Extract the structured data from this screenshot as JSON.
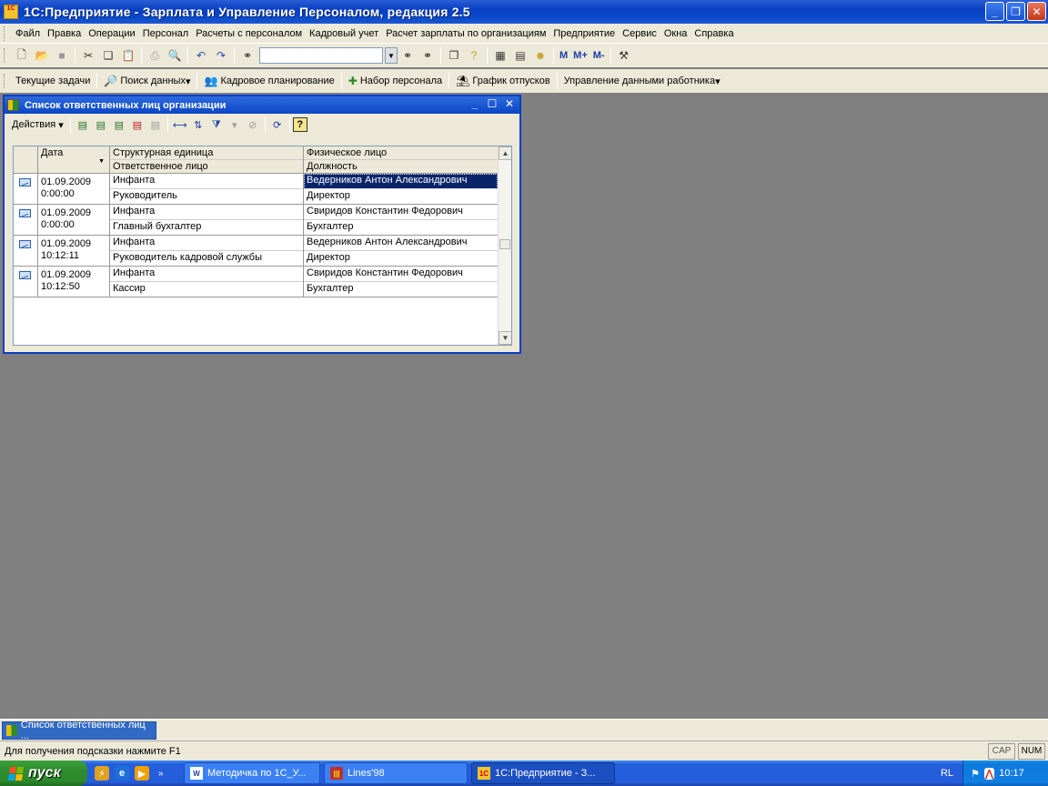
{
  "app": {
    "title": "1С:Предприятие - Зарплата и Управление Персоналом, редакция 2.5",
    "icon_text": "1C"
  },
  "menu": [
    "Файл",
    "Правка",
    "Операции",
    "Персонал",
    "Расчеты с персоналом",
    "Кадровый учет",
    "Расчет зарплаты по организациям",
    "Предприятие",
    "Сервис",
    "Окна",
    "Справка"
  ],
  "toolbar2": {
    "items": [
      "Текущие задачи",
      "Поиск данных",
      "Кадровое планирование",
      "Набор персонала",
      "График отпусков",
      "Управление данными работника"
    ]
  },
  "toolbar1": {
    "m_labels": [
      "M",
      "M+",
      "M-"
    ]
  },
  "child_window": {
    "title": "Список ответственных лиц организации",
    "actions_label": "Действия",
    "help_label": "?"
  },
  "table": {
    "headers": {
      "date": "Дата",
      "unit": "Структурная единица",
      "responsible": "Ответственное лицо",
      "person": "Физическое лицо",
      "position": "Должность"
    },
    "rows": [
      {
        "date": "01.09.2009",
        "time": "0:00:00",
        "unit": "Инфанта",
        "responsible": "Руководитель",
        "person": "Ведерников Антон Александрович",
        "position": "Директор"
      },
      {
        "date": "01.09.2009",
        "time": "0:00:00",
        "unit": "Инфанта",
        "responsible": "Главный бухгалтер",
        "person": "Свиридов Константин Федорович",
        "position": "Бухгалтер"
      },
      {
        "date": "01.09.2009",
        "time": "10:12:11",
        "unit": "Инфанта",
        "responsible": "Руководитель кадровой службы",
        "person": "Ведерников Антон Александрович",
        "position": "Директор"
      },
      {
        "date": "01.09.2009",
        "time": "10:12:50",
        "unit": "Инфанта",
        "responsible": "Кассир",
        "person": "Свиридов Константин Федорович",
        "position": "Бухгалтер"
      }
    ]
  },
  "window_bar": {
    "item": "Список ответственных лиц ..."
  },
  "status": {
    "hint": "Для получения подсказки нажмите F1",
    "cap": "CAP",
    "num": "NUM"
  },
  "taskbar": {
    "start": "пуск",
    "tasks": [
      "Методичка по 1С_У...",
      "Lines'98",
      "1С:Предприятие - З..."
    ],
    "lang": "RL",
    "clock": "10:17"
  },
  "colors": {
    "titlebar": "#0a3fc4",
    "selection": "#0a246a",
    "desktop": "#808080"
  }
}
